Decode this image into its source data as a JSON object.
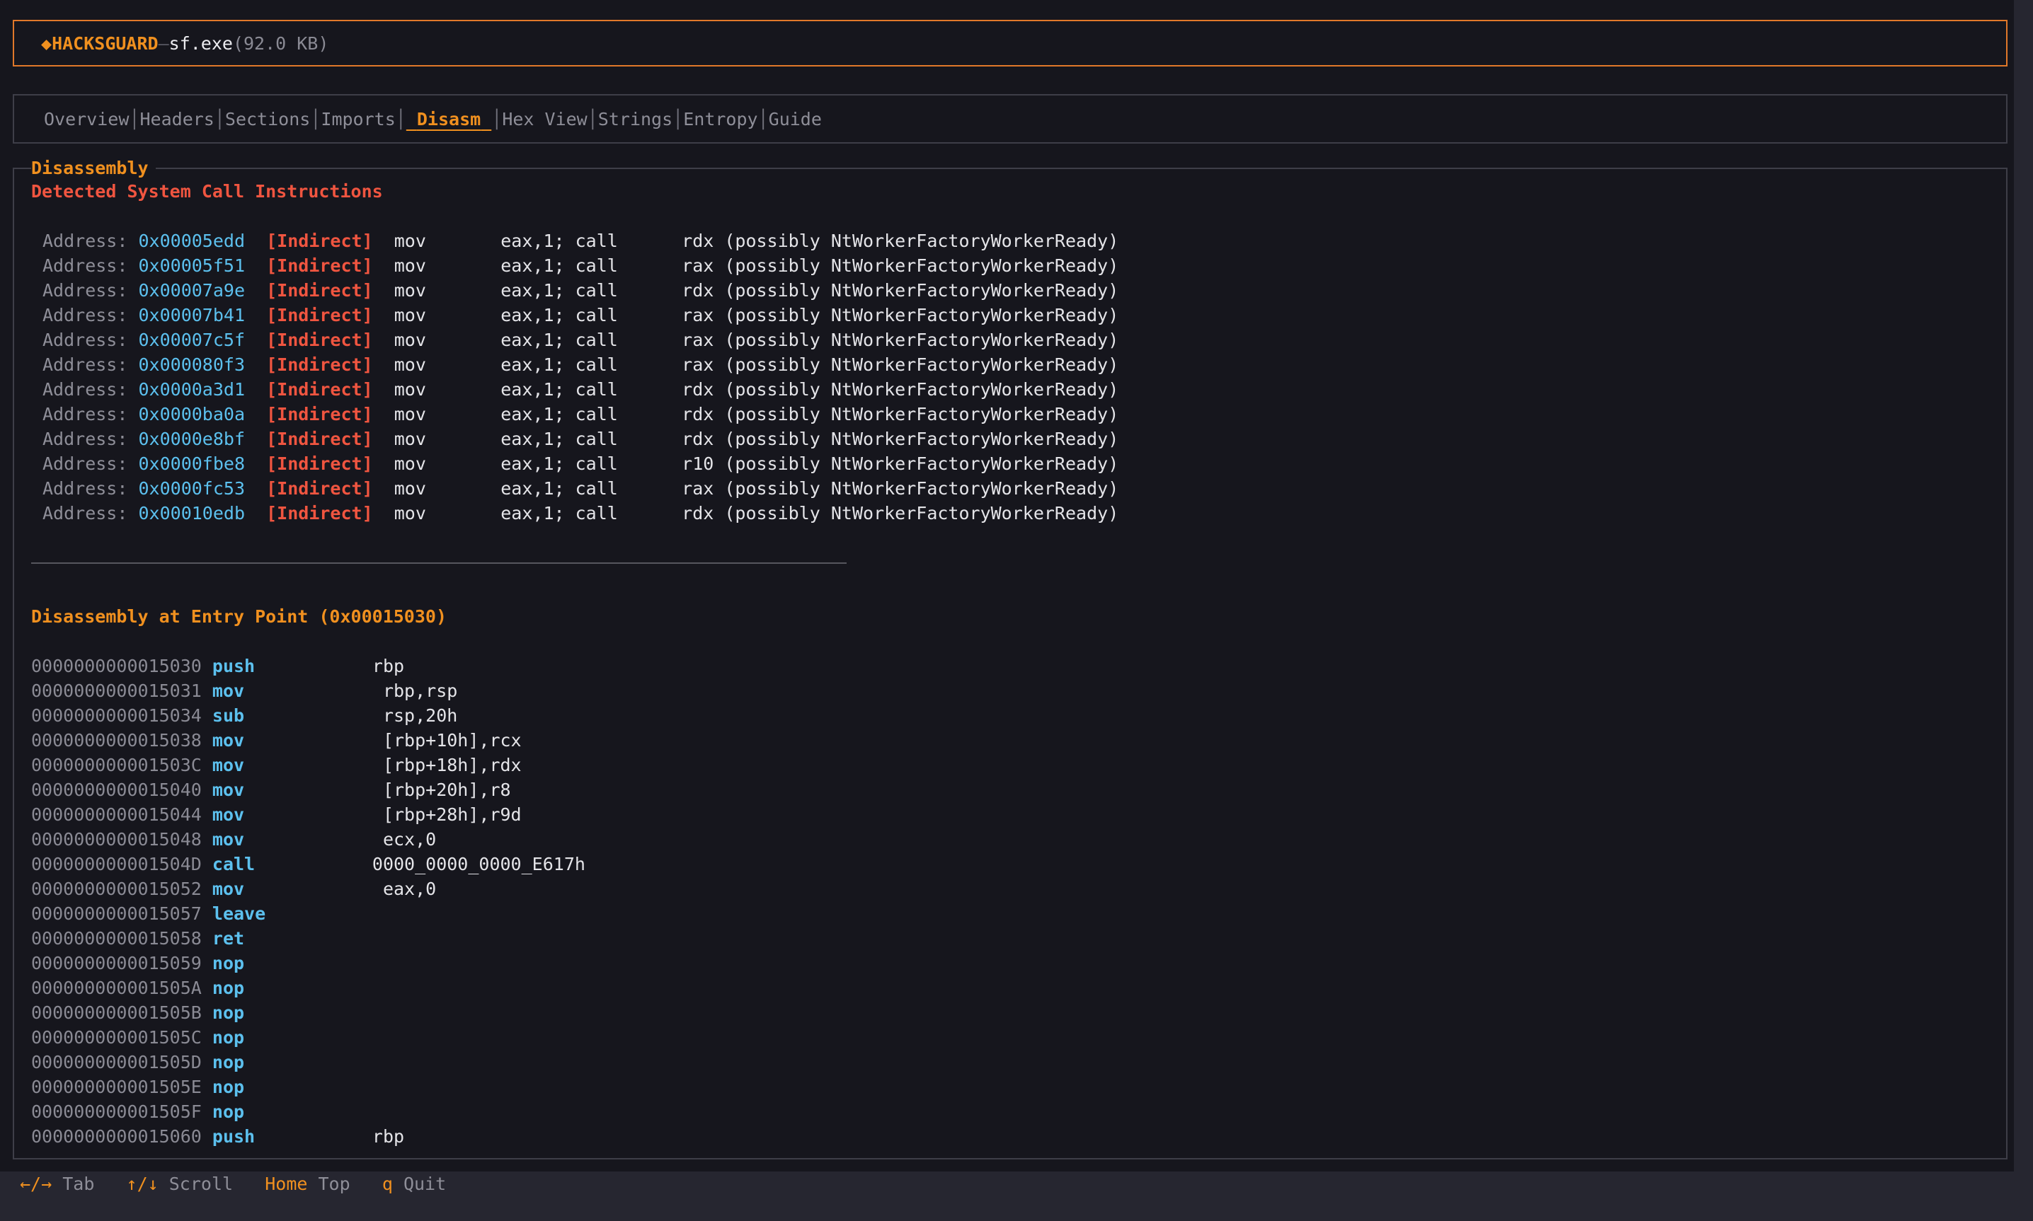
{
  "header": {
    "brand_icon": "◆",
    "brand": "HACKSGUARD",
    "separator": "—",
    "filename": "sf.exe",
    "filesize": "(92.0 KB)"
  },
  "tabs": [
    {
      "label": "Overview",
      "active": false
    },
    {
      "label": "Headers",
      "active": false
    },
    {
      "label": "Sections",
      "active": false
    },
    {
      "label": "Imports",
      "active": false
    },
    {
      "label": "Disasm",
      "active": true
    },
    {
      "label": "Hex View",
      "active": false
    },
    {
      "label": "Strings",
      "active": false
    },
    {
      "label": "Entropy",
      "active": false
    },
    {
      "label": "Guide",
      "active": false
    }
  ],
  "panel": {
    "title": "Disassembly",
    "syscall_heading": "Detected System Call Instructions",
    "syscall_label": "Address:",
    "syscalls": [
      {
        "address": "0x00005edd",
        "tag": "[Indirect]",
        "mnemonic": "mov",
        "operands": "eax,1; call",
        "target": "rdx (possibly NtWorkerFactoryWorkerReady)"
      },
      {
        "address": "0x00005f51",
        "tag": "[Indirect]",
        "mnemonic": "mov",
        "operands": "eax,1; call",
        "target": "rax (possibly NtWorkerFactoryWorkerReady)"
      },
      {
        "address": "0x00007a9e",
        "tag": "[Indirect]",
        "mnemonic": "mov",
        "operands": "eax,1; call",
        "target": "rdx (possibly NtWorkerFactoryWorkerReady)"
      },
      {
        "address": "0x00007b41",
        "tag": "[Indirect]",
        "mnemonic": "mov",
        "operands": "eax,1; call",
        "target": "rax (possibly NtWorkerFactoryWorkerReady)"
      },
      {
        "address": "0x00007c5f",
        "tag": "[Indirect]",
        "mnemonic": "mov",
        "operands": "eax,1; call",
        "target": "rax (possibly NtWorkerFactoryWorkerReady)"
      },
      {
        "address": "0x000080f3",
        "tag": "[Indirect]",
        "mnemonic": "mov",
        "operands": "eax,1; call",
        "target": "rax (possibly NtWorkerFactoryWorkerReady)"
      },
      {
        "address": "0x0000a3d1",
        "tag": "[Indirect]",
        "mnemonic": "mov",
        "operands": "eax,1; call",
        "target": "rdx (possibly NtWorkerFactoryWorkerReady)"
      },
      {
        "address": "0x0000ba0a",
        "tag": "[Indirect]",
        "mnemonic": "mov",
        "operands": "eax,1; call",
        "target": "rdx (possibly NtWorkerFactoryWorkerReady)"
      },
      {
        "address": "0x0000e8bf",
        "tag": "[Indirect]",
        "mnemonic": "mov",
        "operands": "eax,1; call",
        "target": "rdx (possibly NtWorkerFactoryWorkerReady)"
      },
      {
        "address": "0x0000fbe8",
        "tag": "[Indirect]",
        "mnemonic": "mov",
        "operands": "eax,1; call",
        "target": "r10 (possibly NtWorkerFactoryWorkerReady)"
      },
      {
        "address": "0x0000fc53",
        "tag": "[Indirect]",
        "mnemonic": "mov",
        "operands": "eax,1; call",
        "target": "rax (possibly NtWorkerFactoryWorkerReady)"
      },
      {
        "address": "0x00010edb",
        "tag": "[Indirect]",
        "mnemonic": "mov",
        "operands": "eax,1; call",
        "target": "rdx (possibly NtWorkerFactoryWorkerReady)"
      }
    ],
    "entry_heading": "Disassembly at Entry Point (0x00015030)",
    "instructions": [
      {
        "address": "0000000000015030",
        "mnemonic": "push",
        "operands": "rbp"
      },
      {
        "address": "0000000000015031",
        "mnemonic": "mov",
        "operands": " rbp,rsp"
      },
      {
        "address": "0000000000015034",
        "mnemonic": "sub",
        "operands": " rsp,20h"
      },
      {
        "address": "0000000000015038",
        "mnemonic": "mov",
        "operands": " [rbp+10h],rcx"
      },
      {
        "address": "000000000001503C",
        "mnemonic": "mov",
        "operands": " [rbp+18h],rdx"
      },
      {
        "address": "0000000000015040",
        "mnemonic": "mov",
        "operands": " [rbp+20h],r8"
      },
      {
        "address": "0000000000015044",
        "mnemonic": "mov",
        "operands": " [rbp+28h],r9d"
      },
      {
        "address": "0000000000015048",
        "mnemonic": "mov",
        "operands": " ecx,0"
      },
      {
        "address": "000000000001504D",
        "mnemonic": "call",
        "operands": "0000_0000_0000_E617h"
      },
      {
        "address": "0000000000015052",
        "mnemonic": "mov",
        "operands": " eax,0"
      },
      {
        "address": "0000000000015057",
        "mnemonic": "leave",
        "operands": ""
      },
      {
        "address": "0000000000015058",
        "mnemonic": "ret",
        "operands": ""
      },
      {
        "address": "0000000000015059",
        "mnemonic": "nop",
        "operands": ""
      },
      {
        "address": "000000000001505A",
        "mnemonic": "nop",
        "operands": ""
      },
      {
        "address": "000000000001505B",
        "mnemonic": "nop",
        "operands": ""
      },
      {
        "address": "000000000001505C",
        "mnemonic": "nop",
        "operands": ""
      },
      {
        "address": "000000000001505D",
        "mnemonic": "nop",
        "operands": ""
      },
      {
        "address": "000000000001505E",
        "mnemonic": "nop",
        "operands": ""
      },
      {
        "address": "000000000001505F",
        "mnemonic": "nop",
        "operands": ""
      },
      {
        "address": "0000000000015060",
        "mnemonic": "push",
        "operands": "rbp"
      }
    ]
  },
  "footer": [
    {
      "key": "←/→",
      "desc": "Tab"
    },
    {
      "key": "↑/↓",
      "desc": "Scroll"
    },
    {
      "key": "Home",
      "desc": "Top"
    },
    {
      "key": "q",
      "desc": "Quit"
    }
  ],
  "colors": {
    "accent": "#f0901f",
    "address": "#5cc0ee",
    "alert": "#f05540",
    "background": "#16161d"
  }
}
